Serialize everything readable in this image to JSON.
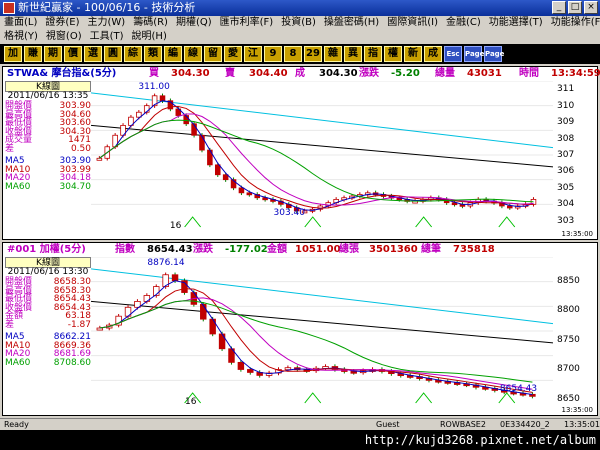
{
  "window": {
    "title": "新世紀贏家 - 100/06/16 - 技術分析"
  },
  "menu": {
    "row1": [
      "畫面(L)",
      "證券(E)",
      "主力(W)",
      "籌碼(R)",
      "期權(Q)",
      "匯市利率(F)",
      "投資(B)",
      "操盤密碼(H)",
      "國際資訊(I)",
      "金融(C)",
      "功能選擇(T)",
      "功能操作(F)"
    ],
    "row2": [
      "格視(Y)",
      "視窗(O)",
      "工具(T)",
      "說明(H)"
    ]
  },
  "toolbar": [
    "加",
    "賺",
    "期",
    "價",
    "選",
    "圓",
    "綜",
    "類",
    "編",
    "線",
    "留",
    "愛",
    "江",
    "9",
    "8",
    "29",
    "雜",
    "異",
    "指",
    "權",
    "新",
    "成"
  ],
  "toolbar_icons": [
    "Esc",
    "Page",
    "Page"
  ],
  "top": {
    "symbol": "STWA& 摩台指&(5分)",
    "buy_label": "買",
    "buy": "304.30",
    "sell_label": "賣",
    "sell": "304.40",
    "trade_label": "成",
    "trade": "304.30",
    "change_label": "漲跌",
    "change": "-5.20",
    "volume_label": "總量",
    "volume": "43031",
    "time_label": "時間",
    "time": "13:34:59",
    "info_title": "K線圖",
    "date": "2011/06/16 13:35",
    "rows": [
      {
        "k": "開盤價",
        "v": "303.90"
      },
      {
        "k": "最高價",
        "v": "304.60"
      },
      {
        "k": "最低價",
        "v": "303.60"
      },
      {
        "k": "收盤價",
        "v": "304.30"
      },
      {
        "k": "成交量",
        "v": "1471"
      },
      {
        "k": "差",
        "v": "0.50"
      }
    ],
    "ma": [
      {
        "k": "MA5",
        "v": "303.90",
        "color": "#0000c0"
      },
      {
        "k": "MA10",
        "v": "303.99",
        "color": "#c00000"
      },
      {
        "k": "MA20",
        "v": "304.18",
        "color": "#c000c0"
      },
      {
        "k": "MA60",
        "v": "304.70",
        "color": "#00a000"
      }
    ],
    "high_label": "311.00",
    "low_label": "303.40",
    "day_label": "16",
    "bottom_time": "13:35:00",
    "y_ticks": [
      "311",
      "310",
      "309",
      "308",
      "307",
      "306",
      "305",
      "304",
      "303"
    ]
  },
  "bottom": {
    "symbol": "#001 加權(5分)",
    "index_label": "指數",
    "index": "8654.43",
    "change_label": "漲跌",
    "change": "-177.02",
    "amount_label": "金額",
    "amount": "1051.00",
    "volume_label": "總張",
    "volume": "3501360",
    "count_label": "總筆",
    "count": "735818",
    "info_title": "K線圖",
    "date": "2011/06/16 13:30",
    "rows": [
      {
        "k": "開盤價",
        "v": "8658.30"
      },
      {
        "k": "最高價",
        "v": "8658.30"
      },
      {
        "k": "最低價",
        "v": "8654.43"
      },
      {
        "k": "收盤價",
        "v": "8654.43"
      },
      {
        "k": "金額",
        "v": "63.18"
      },
      {
        "k": "差",
        "v": "-1.87"
      }
    ],
    "ma": [
      {
        "k": "MA5",
        "v": "8662.21",
        "color": "#0000c0"
      },
      {
        "k": "MA10",
        "v": "8669.36",
        "color": "#c00000"
      },
      {
        "k": "MA20",
        "v": "8681.69",
        "color": "#c000c0"
      },
      {
        "k": "MA60",
        "v": "8708.60",
        "color": "#00a000"
      }
    ],
    "high_label": "8876.14",
    "low_label": "8654.43",
    "day_label": "16",
    "bottom_time": "13:35:00",
    "y_ticks": [
      "8850",
      "8800",
      "8750",
      "8700",
      "8650"
    ]
  },
  "status": {
    "left": "Ready",
    "user": "Guest",
    "server": "ROWBASE2",
    "id": "0E334420_2",
    "clock": "13:35:01"
  },
  "url": "http://kujd3268.pixnet.net/album",
  "chart_data": [
    {
      "type": "candlestick",
      "title": "STWA& 摩台指&(5分)",
      "ylim": [
        302.5,
        311.5
      ],
      "annotations": [
        "311.00",
        "303.40"
      ],
      "closes": [
        306.8,
        307.5,
        308.2,
        308.8,
        309.3,
        309.6,
        310.0,
        310.6,
        310.3,
        309.8,
        309.4,
        308.9,
        308.2,
        307.3,
        306.4,
        305.8,
        305.5,
        305.0,
        304.7,
        304.6,
        304.4,
        304.3,
        304.2,
        304.0,
        303.8,
        303.6,
        303.6,
        303.7,
        303.9,
        304.1,
        304.3,
        304.4,
        304.5,
        304.6,
        304.7,
        304.6,
        304.5,
        304.4,
        304.3,
        304.2,
        304.2,
        304.3,
        304.4,
        304.3,
        304.1,
        304.0,
        303.9,
        304.1,
        304.3,
        304.2,
        304.1,
        303.9,
        303.8,
        303.9,
        304.0,
        304.3
      ]
    },
    {
      "type": "candlestick",
      "title": "#001 加權(5分)",
      "ylim": [
        8640,
        8890
      ],
      "annotations": [
        "8876.14",
        "8654.43"
      ],
      "closes": [
        8770,
        8775,
        8790,
        8805,
        8815,
        8825,
        8840,
        8860,
        8850,
        8830,
        8810,
        8785,
        8760,
        8735,
        8712,
        8700,
        8695,
        8690,
        8694,
        8700,
        8703,
        8700,
        8698,
        8702,
        8705,
        8700,
        8697,
        8695,
        8698,
        8700,
        8697,
        8693,
        8690,
        8688,
        8685,
        8682,
        8680,
        8678,
        8676,
        8674,
        8670,
        8668,
        8665,
        8662,
        8660,
        8658,
        8655
      ]
    }
  ]
}
